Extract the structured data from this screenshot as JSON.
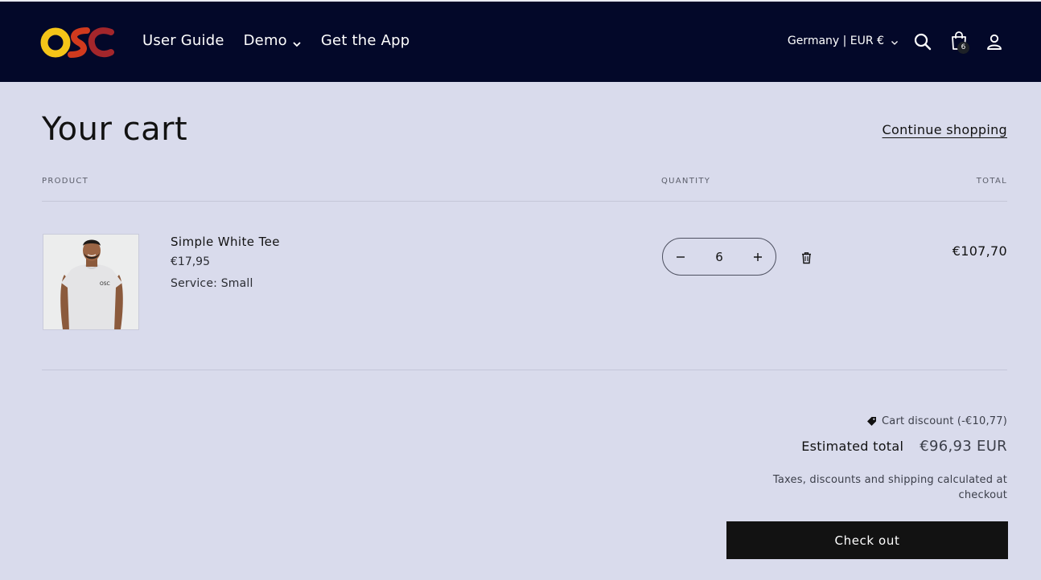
{
  "header": {
    "logo_text": "OSC",
    "nav": [
      {
        "label": "User Guide"
      },
      {
        "label": "Demo"
      },
      {
        "label": "Get the App"
      }
    ],
    "country_selector": "Germany | EUR €",
    "cart_count": "6",
    "icons": [
      "search-icon",
      "cart-icon",
      "account-icon"
    ]
  },
  "cart": {
    "title": "Your cart",
    "continue_shopping": "Continue shopping",
    "columns": {
      "product": "PRODUCT",
      "quantity": "QUANTITY",
      "total": "TOTAL"
    },
    "items": [
      {
        "name": "Simple White Tee",
        "price": "€17,95",
        "variant": "Service: Small",
        "quantity": "6",
        "line_total": "€107,70"
      }
    ]
  },
  "summary": {
    "discount": "Cart discount (-€10,77)",
    "estimated_label": "Estimated total",
    "estimated_value": "€96,93 EUR",
    "taxes_note": "Taxes, discounts and shipping calculated at checkout",
    "checkout_label": "Check out"
  },
  "colors": {
    "header_bg": "#030829",
    "page_bg": "#d9dbec",
    "button_bg": "#121212",
    "logo_yellow": "#f5c518",
    "logo_red": "#c2272d"
  }
}
